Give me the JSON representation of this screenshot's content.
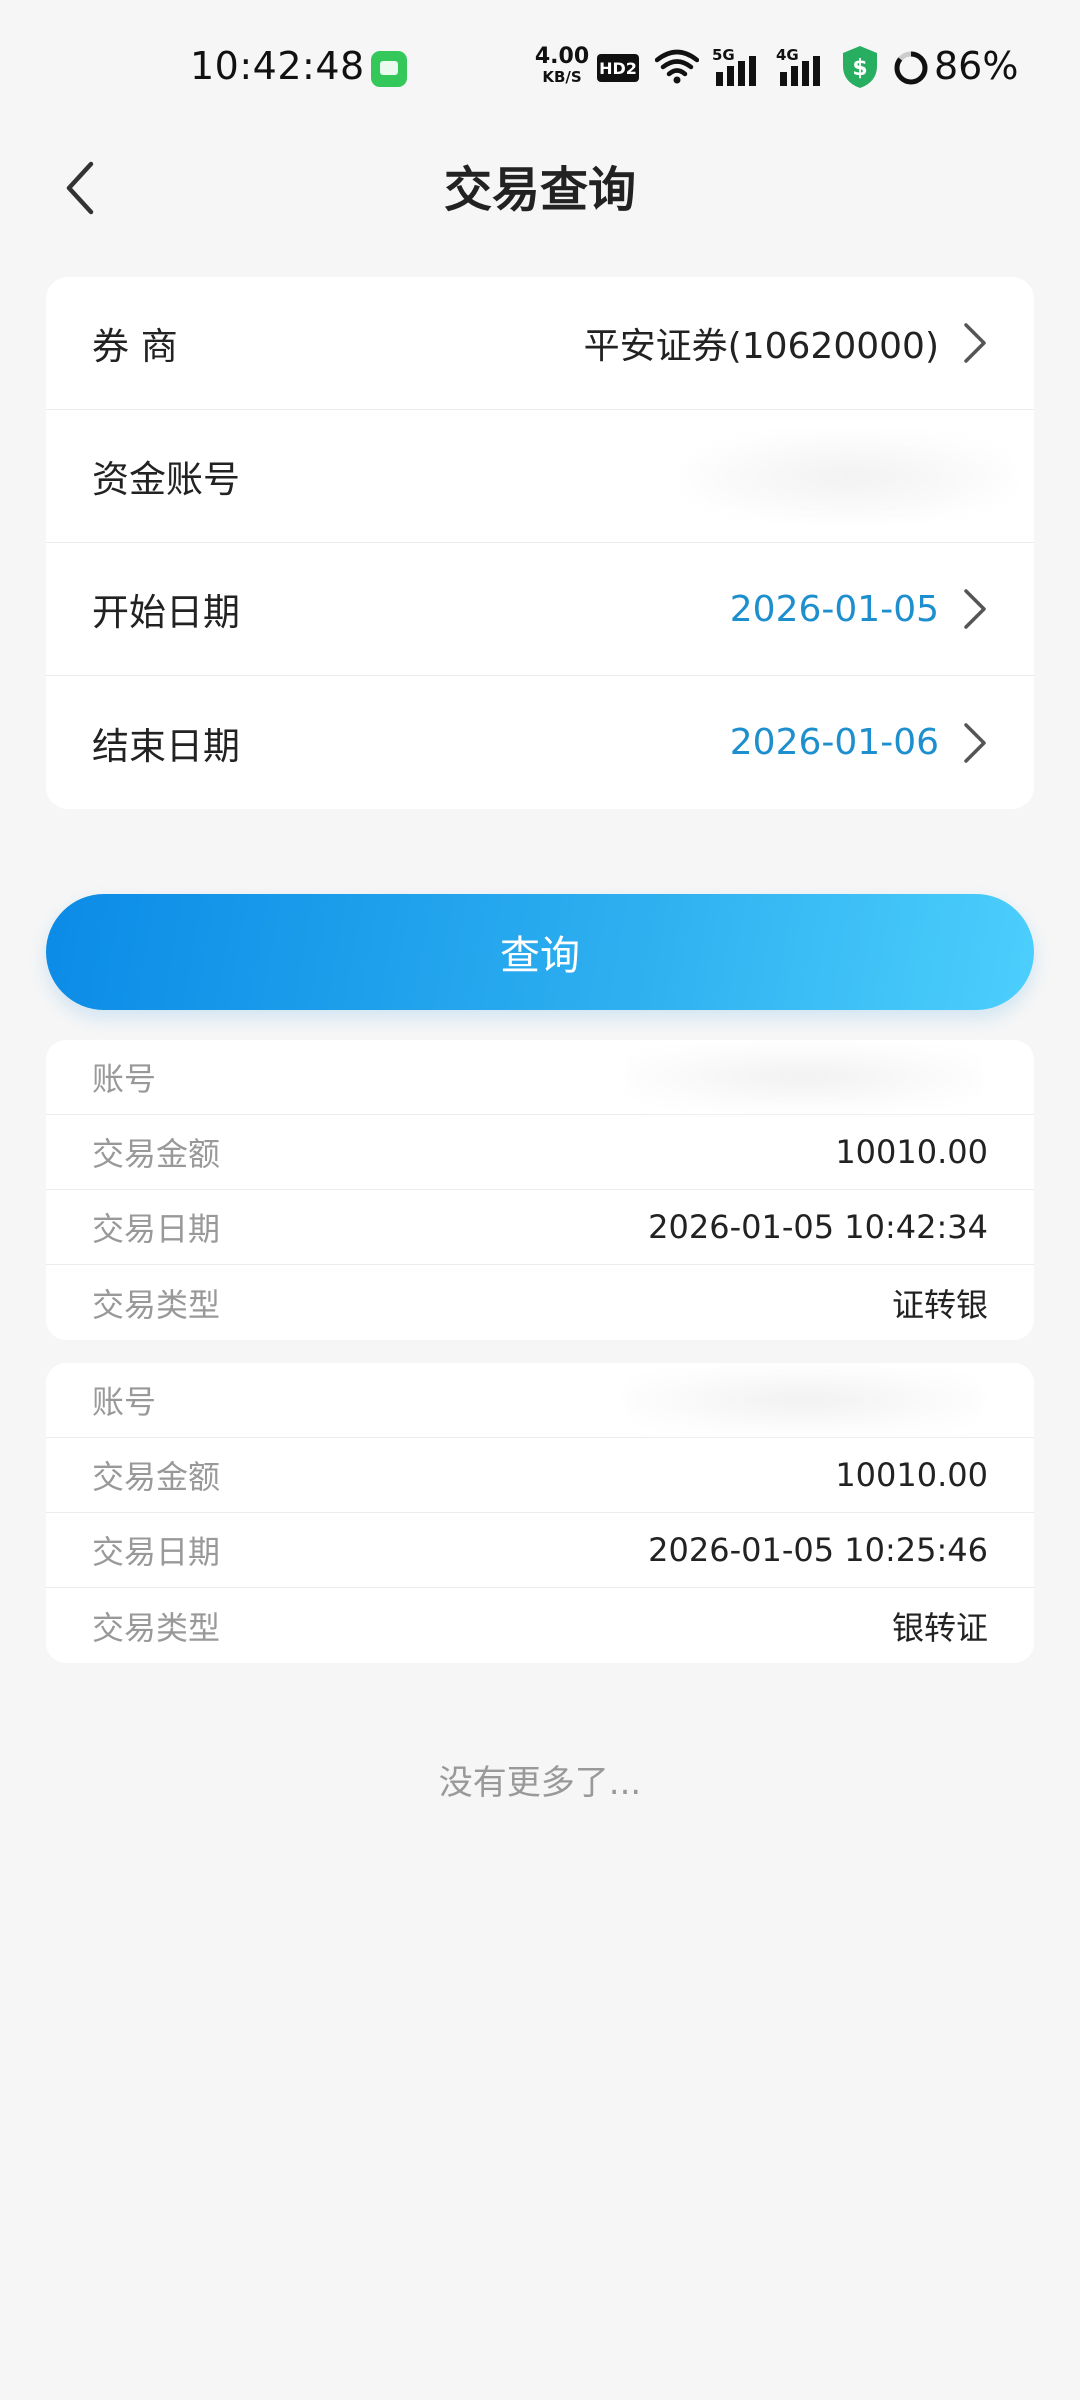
{
  "status_bar": {
    "time": "10:42:48",
    "net_speed_value": "4.00",
    "net_speed_unit": "KB/S",
    "hd_label": "HD2",
    "sim1_label": "5G",
    "sim2_label": "4G",
    "battery_percent": "86%"
  },
  "header": {
    "title": "交易查询"
  },
  "form": {
    "broker_label": "券 商",
    "broker_value": "平安证券(10620000)",
    "account_label": "资金账号",
    "start_date_label": "开始日期",
    "start_date_value": "2026-01-05",
    "end_date_label": "结束日期",
    "end_date_value": "2026-01-06"
  },
  "query_button": {
    "label": "查询"
  },
  "results": [
    {
      "account_label": "账号",
      "amount_label": "交易金额",
      "amount_value": "10010.00",
      "date_label": "交易日期",
      "date_value": "2026-01-05 10:42:34",
      "type_label": "交易类型",
      "type_value": "证转银"
    },
    {
      "account_label": "账号",
      "amount_label": "交易金额",
      "amount_value": "10010.00",
      "date_label": "交易日期",
      "date_value": "2026-01-05 10:25:46",
      "type_label": "交易类型",
      "type_value": "银转证"
    }
  ],
  "footer": {
    "no_more_text": "没有更多了..."
  },
  "colors": {
    "accent_date": "#1e8fce",
    "button_gradient_start": "#0b8be6",
    "button_gradient_end": "#4ccffc",
    "background": "#f6f6f6"
  }
}
